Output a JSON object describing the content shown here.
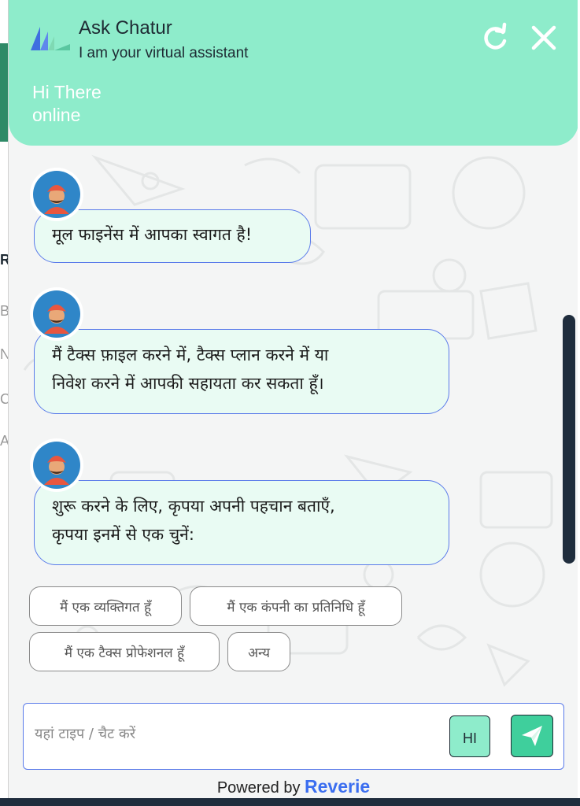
{
  "header": {
    "title": "Ask Chatur",
    "subtitle": "I am your virtual assistant",
    "greeting": "Hi There",
    "status": "online"
  },
  "messages": [
    {
      "text": "मूल फाइनेंस में आपका स्वागत है!"
    },
    {
      "line1": "मैं टैक्स फ़ाइल करने में, टैक्स प्लान करने में या",
      "line2": "निवेश करने में आपकी सहायता कर सकता हूँ।"
    },
    {
      "line1": "शुरू करने के लिए, कृपया अपनी पहचान बताएँ,",
      "line2": "कृपया इनमें से एक चुनें:"
    }
  ],
  "quick_replies": [
    "मैं एक व्यक्तिगत हूँ",
    "मैं एक कंपनी का प्रतिनिधि हूँ",
    "मैं एक टैक्स प्रोफेशनल हूँ",
    "अन्य"
  ],
  "composer": {
    "placeholder": "यहां टाइप / चैट करें",
    "language_label": "HI"
  },
  "footer": {
    "powered_by": "Powered by",
    "brand": "Reverie"
  },
  "background_page": {
    "letters": [
      "R",
      "B",
      "N",
      "C",
      "A"
    ]
  },
  "colors": {
    "header_bg": "#8eeccb",
    "bubble_bg": "#e9fbf3",
    "bubble_border": "#5b7bea",
    "send_bg": "#3fcf9c",
    "brand": "#3b6ef0",
    "scrollbar": "#1f2d3d"
  },
  "icons": {
    "logo": "chatur-logo-icon",
    "refresh": "refresh-icon",
    "close": "close-icon",
    "avatar": "turban-man-avatar-icon",
    "send": "paper-plane-send-icon"
  }
}
